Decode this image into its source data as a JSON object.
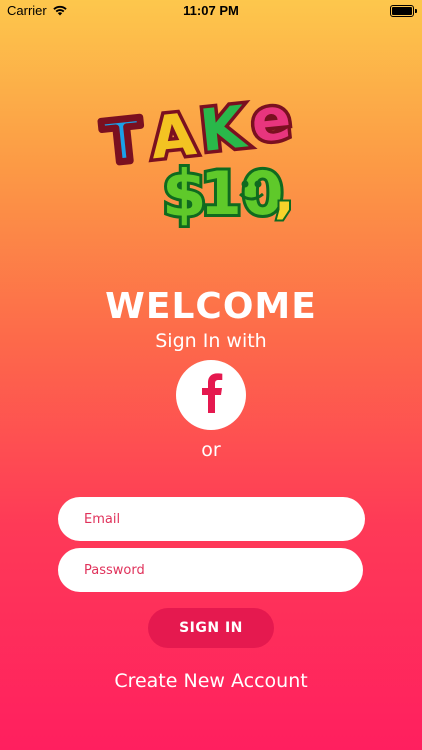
{
  "status_bar": {
    "carrier": "Carrier",
    "time": "11:07 PM",
    "icons": [
      "wifi-icon",
      "battery-icon"
    ]
  },
  "logo": {
    "line1": "TAKE",
    "line2": "$10",
    "colors": {
      "outline": "#7a1020",
      "t": "#1aa0e8",
      "a": "#f3c322",
      "k": "#29b84a",
      "e": "#e8357e",
      "money_green": "#5fc92a",
      "smile_yellow": "#f6d22a"
    }
  },
  "welcome": {
    "title": "WELCOME",
    "subtitle": "Sign In with",
    "facebook_icon": "facebook-icon",
    "or": "or"
  },
  "form": {
    "email_placeholder": "Email",
    "password_placeholder": "Password",
    "signin_label": "SIGN IN",
    "create_account_label": "Create New Account"
  },
  "colors": {
    "gradient_top": "#fdc74c",
    "gradient_bottom": "#ff1f5f",
    "accent": "#e5194f",
    "input_text": "#e0325b",
    "facebook": "#e5194f"
  }
}
